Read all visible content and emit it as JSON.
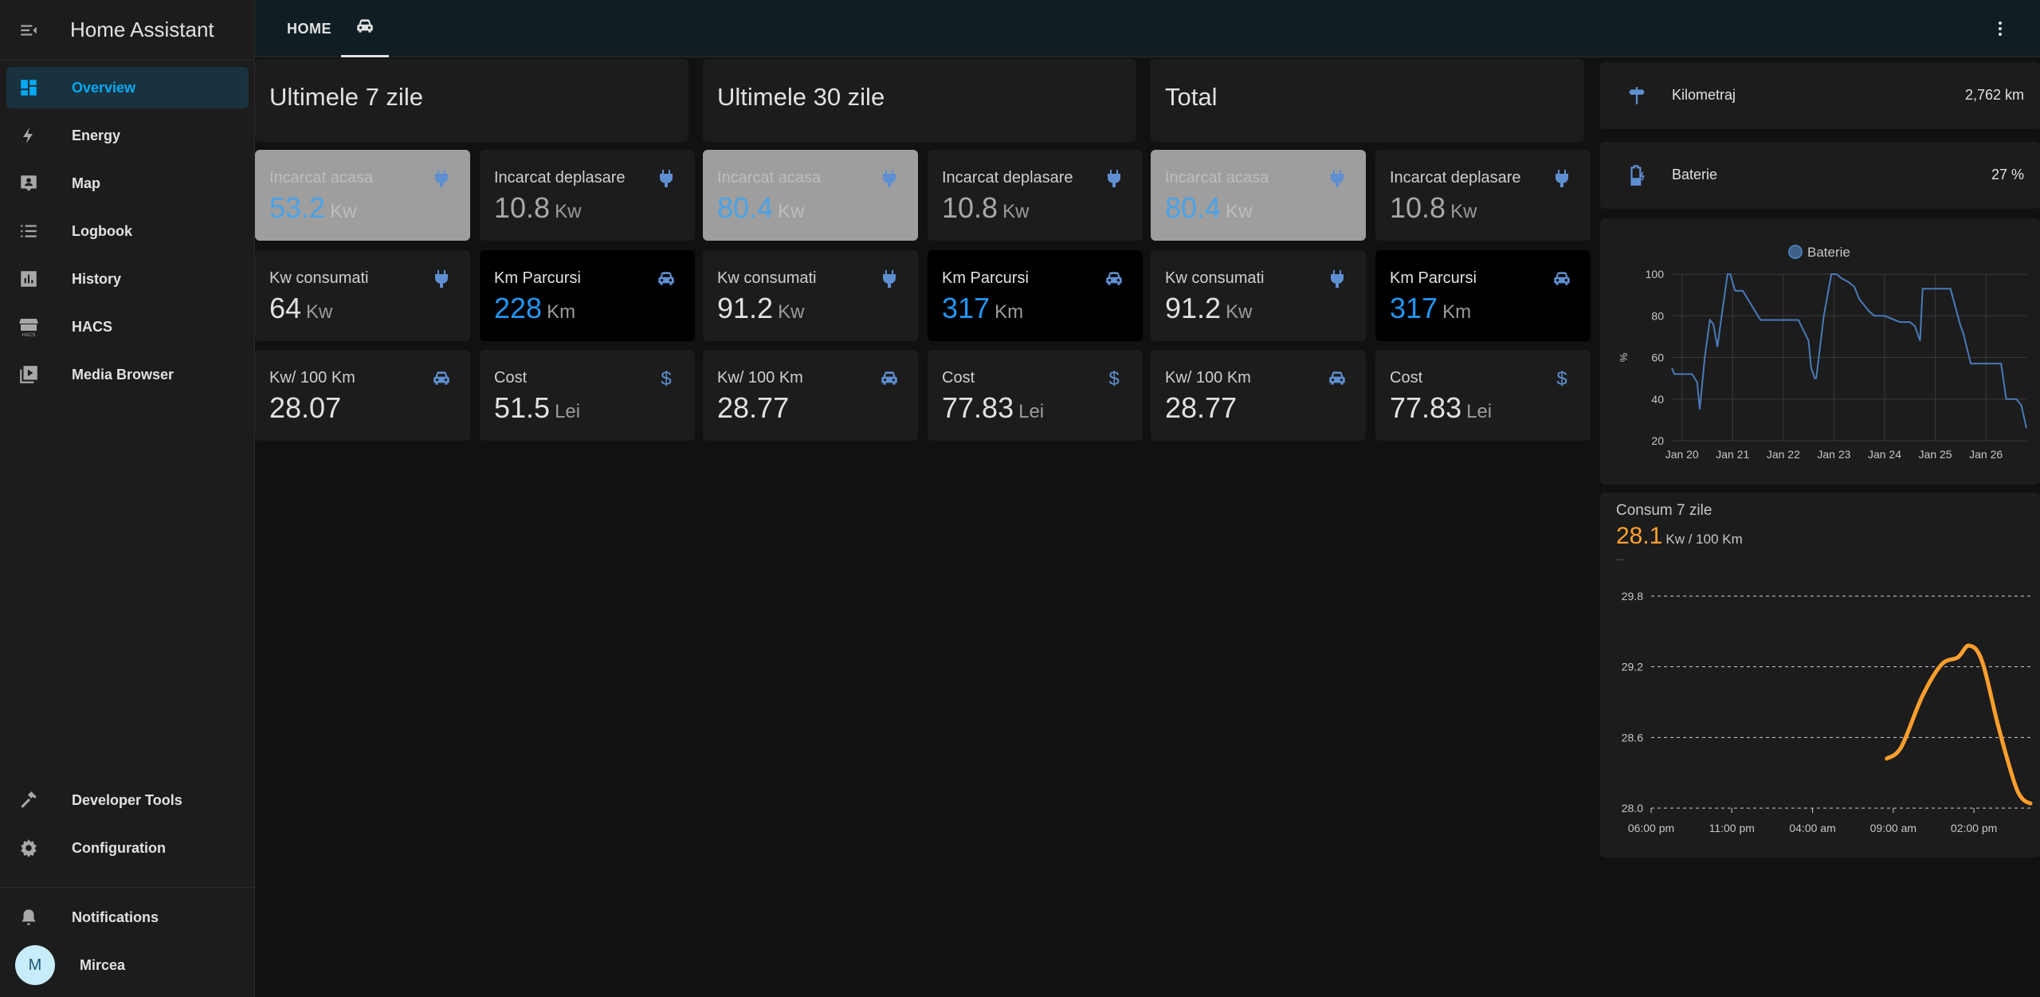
{
  "app": {
    "title": "Home Assistant"
  },
  "sidebar": {
    "items": [
      {
        "label": "Overview",
        "icon": "dashboard-icon",
        "active": true
      },
      {
        "label": "Energy",
        "icon": "lightning-icon"
      },
      {
        "label": "Map",
        "icon": "map-account-icon"
      },
      {
        "label": "Logbook",
        "icon": "logbook-list-icon"
      },
      {
        "label": "History",
        "icon": "chart-box-icon"
      },
      {
        "label": "HACS",
        "icon": "hacs-store-icon",
        "icon_caption": "HACS"
      },
      {
        "label": "Media Browser",
        "icon": "media-play-icon"
      }
    ],
    "bottom_items": [
      {
        "label": "Developer Tools",
        "icon": "hammer-icon"
      },
      {
        "label": "Configuration",
        "icon": "gear-icon"
      }
    ],
    "notifications": {
      "label": "Notifications",
      "icon": "bell-icon"
    },
    "user": {
      "name": "Mircea",
      "initial": "M"
    }
  },
  "topbar": {
    "tabs": [
      {
        "label": "HOME"
      },
      {
        "label": "",
        "icon": "car-icon",
        "active": true
      }
    ]
  },
  "columns": [
    {
      "title": "Ultimele 7 zile",
      "tiles": [
        {
          "name": "Incarcat acasa",
          "value": "53.2",
          "unit": "Kw",
          "icon": "plug-icon",
          "style": "light"
        },
        {
          "name": "Incarcat deplasare",
          "value": "10.8",
          "unit": "Kw",
          "icon": "plug-icon",
          "style": "dim"
        },
        {
          "name": "Kw consumati",
          "value": "64",
          "unit": "Kw",
          "icon": "plug-icon",
          "style": "normal"
        },
        {
          "name": "Km Parcursi",
          "value": "228",
          "unit": "Km",
          "icon": "car-icon",
          "style": "black"
        },
        {
          "name": "Kw/ 100 Km",
          "value": "28.07",
          "unit": "",
          "icon": "car-icon",
          "style": "normal"
        },
        {
          "name": "Cost",
          "value": "51.5",
          "unit": "Lei",
          "icon": "dollar-icon",
          "style": "normal"
        }
      ]
    },
    {
      "title": "Ultimele 30 zile",
      "tiles": [
        {
          "name": "Incarcat acasa",
          "value": "80.4",
          "unit": "Kw",
          "icon": "plug-icon",
          "style": "light"
        },
        {
          "name": "Incarcat deplasare",
          "value": "10.8",
          "unit": "Kw",
          "icon": "plug-icon",
          "style": "dim"
        },
        {
          "name": "Kw consumati",
          "value": "91.2",
          "unit": "Kw",
          "icon": "plug-icon",
          "style": "normal"
        },
        {
          "name": "Km Parcursi",
          "value": "317",
          "unit": "Km",
          "icon": "car-icon",
          "style": "black"
        },
        {
          "name": "Kw/ 100 Km",
          "value": "28.77",
          "unit": "",
          "icon": "car-icon",
          "style": "normal"
        },
        {
          "name": "Cost",
          "value": "77.83",
          "unit": "Lei",
          "icon": "dollar-icon",
          "style": "normal"
        }
      ]
    },
    {
      "title": "Total",
      "tiles": [
        {
          "name": "Incarcat acasa",
          "value": "80.4",
          "unit": "Kw",
          "icon": "plug-icon",
          "style": "light"
        },
        {
          "name": "Incarcat deplasare",
          "value": "10.8",
          "unit": "Kw",
          "icon": "plug-icon",
          "style": "dim"
        },
        {
          "name": "Kw consumati",
          "value": "91.2",
          "unit": "Kw",
          "icon": "plug-icon",
          "style": "normal"
        },
        {
          "name": "Km Parcursi",
          "value": "317",
          "unit": "Km",
          "icon": "car-icon",
          "style": "black"
        },
        {
          "name": "Kw/ 100 Km",
          "value": "28.77",
          "unit": "",
          "icon": "car-icon",
          "style": "normal"
        },
        {
          "name": "Cost",
          "value": "77.83",
          "unit": "Lei",
          "icon": "dollar-icon",
          "style": "normal"
        }
      ]
    }
  ],
  "entities": [
    {
      "name": "Kilometraj",
      "value": "2,762 km",
      "icon": "signpost-icon"
    },
    {
      "name": "Baterie",
      "value": "27 %",
      "icon": "battery-charging-icon"
    }
  ],
  "colors": {
    "accent": "#03a9f4",
    "series_blue": "#4a7ab8",
    "series_orange": "#ff9f2e",
    "tile_icon": "#5e8fd0"
  },
  "chart_data": [
    {
      "type": "line",
      "legend": [
        "Baterie"
      ],
      "legend_position": "top-center",
      "ylabel": "%",
      "ylim": [
        20,
        100
      ],
      "yticks": [
        20,
        40,
        60,
        80,
        100
      ],
      "xticks": [
        "Jan 20",
        "Jan 21",
        "Jan 22",
        "Jan 23",
        "Jan 24",
        "Jan 25",
        "Jan 26"
      ],
      "xlim": [
        19.8,
        26.8
      ],
      "grid": true,
      "series": [
        {
          "name": "Baterie",
          "x": [
            19.8,
            19.85,
            19.95,
            20.2,
            20.3,
            20.35,
            20.45,
            20.55,
            20.62,
            20.7,
            20.8,
            20.9,
            20.95,
            21.05,
            21.2,
            21.5,
            21.55,
            22.0,
            22.1,
            22.3,
            22.5,
            22.55,
            22.62,
            22.65,
            22.8,
            22.95,
            23.05,
            23.15,
            23.3,
            23.4,
            23.5,
            23.6,
            23.7,
            23.8,
            24.0,
            24.3,
            24.5,
            24.6,
            24.7,
            24.75,
            24.8,
            25.0,
            25.3,
            25.5,
            25.55,
            25.7,
            26.0,
            26.3,
            26.4,
            26.6,
            26.7,
            26.8
          ],
          "y": [
            55,
            52,
            52,
            52,
            48,
            35,
            60,
            78,
            76,
            65,
            83,
            100,
            100,
            92,
            92,
            80,
            78,
            78,
            78,
            78,
            68,
            55,
            50,
            50,
            80,
            100,
            100,
            98,
            96,
            94,
            88,
            85,
            82,
            80,
            80,
            77,
            77,
            75,
            68,
            93,
            93,
            93,
            93,
            75,
            72,
            57,
            57,
            57,
            40,
            40,
            37,
            26
          ]
        }
      ]
    },
    {
      "type": "line",
      "title": "Consum 7 zile",
      "current_value": "28.1",
      "unit": "Kw / 100 Km",
      "sublabel": "...",
      "yticks": [
        28.0,
        28.6,
        29.2,
        29.8
      ],
      "ylim": [
        28.0,
        29.8
      ],
      "xticks": [
        "06:00 pm",
        "11:00 pm",
        "04:00 am",
        "09:00 am",
        "02:00 pm"
      ],
      "x_hours": [
        0,
        5,
        10,
        15,
        20
      ],
      "xlim": [
        0,
        23.5
      ],
      "grid": true,
      "series": [
        {
          "name": "",
          "x": [
            14.6,
            15.5,
            16.8,
            18.0,
            19.0,
            19.7,
            20.5,
            21.5,
            22.5,
            23.0,
            23.5
          ],
          "y": [
            28.42,
            28.52,
            28.95,
            29.22,
            29.28,
            29.38,
            29.25,
            28.7,
            28.22,
            28.08,
            28.04
          ]
        }
      ]
    }
  ]
}
